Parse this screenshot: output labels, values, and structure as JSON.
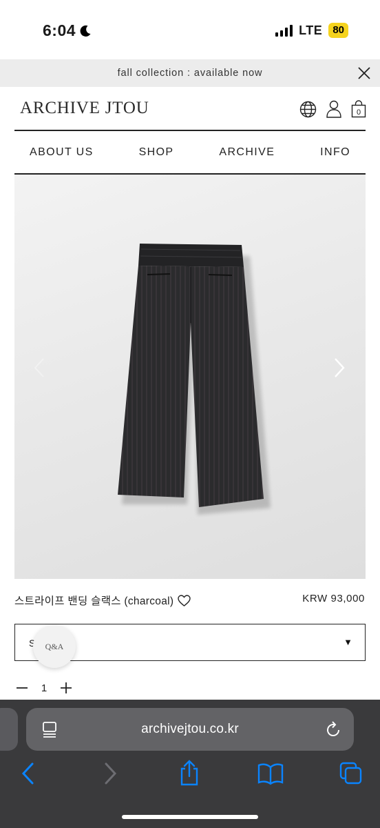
{
  "status_bar": {
    "time": "6:04",
    "network": "LTE",
    "battery": "80"
  },
  "announcement": {
    "text": "fall collection : available now"
  },
  "header": {
    "logo": "ARCHIVE JTOU",
    "icons": [
      "globe-icon",
      "user-icon",
      "shopping-bag-icon"
    ],
    "cart_count": "0"
  },
  "nav": {
    "items": [
      {
        "label": "ABOUT US"
      },
      {
        "label": "SHOP"
      },
      {
        "label": "ARCHIVE"
      },
      {
        "label": "INFO"
      }
    ]
  },
  "product": {
    "name": "스트라이프 밴딩 슬랙스 (charcoal)",
    "price": "KRW 93,000",
    "option_partial": "S",
    "quantity": "1",
    "image_subject": "charcoal striped banded slacks"
  },
  "qa_button": {
    "label": "Q&A"
  },
  "browser": {
    "url": "archivejtou.co.kr"
  },
  "colors": {
    "accent_battery": "#f5d31e",
    "safari_blue": "#0a84ff",
    "browser_bg": "#3a3a3c",
    "url_bar_bg": "#636366"
  }
}
